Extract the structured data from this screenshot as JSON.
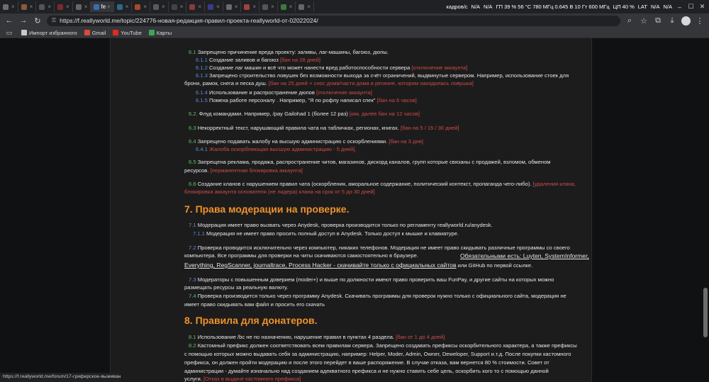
{
  "browser": {
    "tabs": [
      {
        "label": "",
        "color": "#6d6d6d"
      },
      {
        "label": "",
        "color": "#8a5a3a"
      },
      {
        "label": "",
        "color": "#555"
      },
      {
        "label": "",
        "color": "#7a2b2b"
      },
      {
        "label": "",
        "color": "#666"
      },
      {
        "label": "fe",
        "color": "#3a6db0",
        "active": true
      },
      {
        "label": "",
        "color": "#2b6a8a"
      },
      {
        "label": "",
        "color": "#a34a2a"
      },
      {
        "label": "",
        "color": "#5a5a5a"
      },
      {
        "label": "",
        "color": "#444"
      },
      {
        "label": "",
        "color": "#8b3a3a"
      },
      {
        "label": "",
        "color": "#3a3a8b"
      },
      {
        "label": "",
        "color": "#6a6a6a"
      },
      {
        "label": "",
        "color": "#a34040"
      },
      {
        "label": "",
        "color": "#555"
      },
      {
        "label": "",
        "color": "#3c7a3c"
      },
      {
        "label": "",
        "color": "#666"
      }
    ],
    "tray": {
      "fps": "кадров/с",
      "na1": "N/A",
      "na2": "N/A",
      "gpu": "ГП 39 % 56 °C 780 МГц 0.645 В 10 Гт 600 МГц",
      "cpu": "ЦП 40 %",
      "lat": "LAT",
      "na3": "N/A",
      "na4": "N/A"
    },
    "url": "https://f.reallyworld.me/topic/224776-новая-редакция-правил-проекта-reallyworld-от-02022024/",
    "bookmarks": [
      {
        "label": "Импорт избранного",
        "color": "#c9c9c9"
      },
      {
        "label": "Gmail",
        "color": "#d94a3b"
      },
      {
        "label": "YouTube",
        "color": "#e02b20"
      },
      {
        "label": "Карты",
        "color": "#3aa757"
      }
    ]
  },
  "article": {
    "rules": [
      {
        "num": "6.1",
        "nc": "g",
        "text": "Запрещено причинение вреда проекту: заливы, лаг-машины, багоюз, дюпы.",
        "pen": ""
      },
      {
        "num": "6.1.1",
        "nc": "b",
        "text": "Создание заливов и багоюз",
        "pen": "[бан на 28 дней]"
      },
      {
        "num": "6.1.2",
        "nc": "b",
        "text": "Создание лаг машин и всё что может нанести вред работоспособности сервера",
        "pen": "[отключение аккаунта]"
      },
      {
        "num": "6.1.3",
        "nc": "b",
        "text": "Запрещено строительство ловушек без возможности выхода за счёт ограничений, выдвинутые сервером. Например, использование стоек для",
        "pen": ""
      },
      {
        "num": "",
        "nc": "b",
        "text": "брони, рамок, снега и песка душ.",
        "pen": "[бан на 25 дней + снос дома/части дома в регионе, котором находилась ловушка]"
      },
      {
        "num": "6.1.4",
        "nc": "b",
        "text": "Использование и распространение дюпов",
        "pen": "[отключение аккаунта]"
      },
      {
        "num": "6.1.5",
        "nc": "b",
        "text": "Помеха работе персоналу . Например, \"Я по рофлу написал спек\"",
        "pen": "[бан на 6 часов]"
      },
      {
        "num": "6.2.",
        "nc": "g",
        "text": "Флуд командами. Например, /pay Gailohad 1 (более 12 раз)",
        "pen": "[кик, далее бан на 12 часов]"
      },
      {
        "num": "6.3",
        "nc": "g",
        "text": "Некорректный текст, нарушающий правила чата на табличках, регионах, книгах.",
        "pen": "[бан на 5 / 15 / 30 дней]"
      },
      {
        "num": "6.4",
        "nc": "g",
        "text": "Запрещено подавать жалобу на высшую администрацию с оскорблениями.",
        "pen": "[бан на 3 дня]"
      },
      {
        "num": "6.4.1",
        "nc": "b",
        "text": "",
        "pen": "Жалоба оскорбляющая высшую администрацию - 5 дней]."
      },
      {
        "num": "6.5",
        "nc": "g",
        "text": "Запрещена реклама, продажа, распространение читов, магазинов, дискорд каналов, групп которые связаны с продажей, взломом, обменом",
        "pen": ""
      },
      {
        "num": "",
        "nc": "g",
        "text": "ресурсов.",
        "pen": "[перманентная блокировка аккаунта]"
      },
      {
        "num": "6.6",
        "nc": "g",
        "text": "Создание кланов с нарушением правил чата (оскорбления, аморальное содержание, политический контекст, пропаганда чего-либо).",
        "pen": "[удаления клана,"
      },
      {
        "num": "",
        "nc": "g",
        "text": "",
        "pen": "блокировка аккаунта основателя (не лидера) клана на срок от 5 до 30 дней]"
      }
    ],
    "section7_title": "7. Права модерации на проверке.",
    "section7": [
      {
        "num": "7.1",
        "nc": "b",
        "text": "Модерация имеет право вызвать через Anydesk, проверка производится только по регламенту reallyworld.ru/anydesk.",
        "pen": ""
      },
      {
        "num": "7.1.1",
        "nc": "b",
        "text": "Модерация не имеет право просить полный доступ в Anydesk. Только доступ к мышке и клавиатуре.",
        "pen": ""
      },
      {
        "num": "7.2",
        "nc": "b",
        "text": "Проверка проводится исключительно через компьютер, никаких телефонов. Модерация не имеет право скидывать различные программы со своего",
        "pen": ""
      },
      {
        "num": "",
        "nc": "b",
        "text": "компьютера. Все программы для проверки на читы скачиваются самостоятельно в браузере.",
        "pen": ""
      },
      {
        "num": "7.3",
        "nc": "b",
        "text": "Модераторы с повышенным доверием (moder+) и выше по должности имеют право проверить ваш FunPay, и другие сайты на которых можно",
        "pen": ""
      },
      {
        "num": "",
        "nc": "b",
        "text": "размещать ресурсы за реальную валюту.",
        "pen": ""
      },
      {
        "num": "7.4",
        "nc": "g",
        "text": "Проверка производится только через программу Anydesk. Скачивать программы для проверок нужно только с официального сайта, модерация не",
        "pen": ""
      },
      {
        "num": "",
        "nc": "g",
        "text": "имеет право скидывать вам файл и просить его скачать",
        "pen": ""
      }
    ],
    "required_label": "Обязательными есть: Luyten, SystemInformer,",
    "required_line2": "Everything, RegScanner, journaltrace, Process Hacker - скачивайте только с официальных сайтов",
    "required_tail": "или GitHub по первой ссылке.",
    "section8_title": "8. Правила для донатеров.",
    "section8": [
      {
        "num": "8.1",
        "nc": "g",
        "text": "Использование /bc не по назначению, нарушение правил в пунктах 4 раздела.",
        "pen": "[бан от 1 до 4 дней]"
      },
      {
        "num": "8.2",
        "nc": "g",
        "text": "Кастомный префикс должен соответствовать всем правилам сервера. Запрещено создавать префиксы оскорбительного характера, а также префиксы",
        "pen": ""
      },
      {
        "num": "",
        "nc": "g",
        "text": "с помощью которых можно выдавать себя за администрацию, например: Helper, Moder, Admin, Owner, Deweloper, Support и.т.д. После покупки кастомного",
        "pen": ""
      },
      {
        "num": "",
        "nc": "g",
        "text": "префикса, он должен пройти модерацию и после этого перейдет в ваше распоряжение. В случае отказа, вам вернется 80 % стоимости. Совет от",
        "pen": ""
      },
      {
        "num": "",
        "nc": "g",
        "text": "администрации - думайте изначально над созданием адекватного префикса и не нужно ставить себе цель, оскорбить кого то с помощью данной",
        "pen": ""
      },
      {
        "num": "",
        "nc": "g",
        "text": "услуги.",
        "pen": "[Отказ в выдаче кастомного префикса]"
      }
    ]
  },
  "status_url": "https://f.reallyworld.me/forum/17-гриферское-выживание/"
}
